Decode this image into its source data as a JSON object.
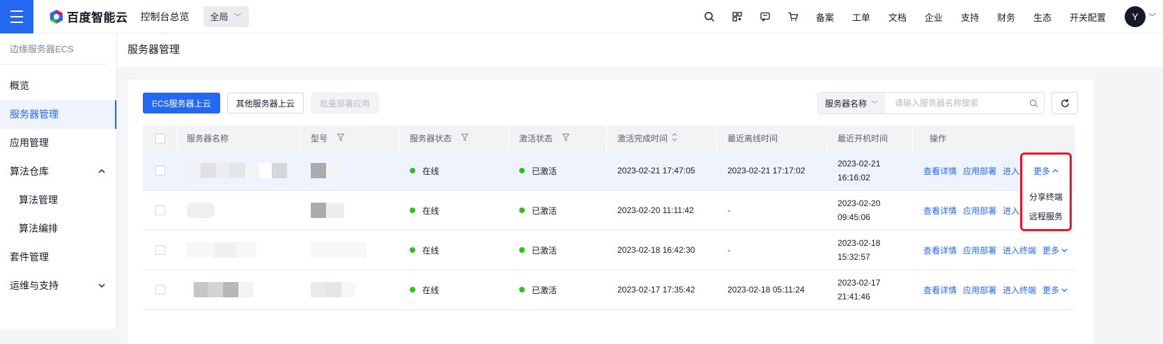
{
  "topbar": {
    "brand": "百度智能云",
    "console": "控制台总览",
    "region": "全局",
    "nav": [
      "备案",
      "工单",
      "文档",
      "企业",
      "支持",
      "财务",
      "生态",
      "开关配置"
    ],
    "avatar": "Y"
  },
  "sidebar": {
    "title": "边缘服务器ECS",
    "items": [
      {
        "label": "概览"
      },
      {
        "label": "服务器管理"
      },
      {
        "label": "应用管理"
      },
      {
        "label": "算法仓库"
      },
      {
        "label": "算法管理"
      },
      {
        "label": "算法编排"
      },
      {
        "label": "套件管理"
      },
      {
        "label": "运维与支持"
      }
    ]
  },
  "page": {
    "title": "服务器管理"
  },
  "toolbar": {
    "ecs_upload": "ECS服务器上云",
    "other_upload": "其他服务器上云",
    "batch_deploy": "批量部署应用",
    "search_type": "服务器名称",
    "search_placeholder": "请输入服务器名称搜索"
  },
  "table": {
    "headers": [
      "服务器名称",
      "型号",
      "服务器状态",
      "激活状态",
      "激活完成时间",
      "最近离线时间",
      "最近开机时间",
      "操作"
    ],
    "rows": [
      {
        "status": "在线",
        "activation": "已激活",
        "activated_at": "2023-02-21 17:47:05",
        "offline_at": "2023-02-21 17:17:02",
        "boot_date": "2023-02-21",
        "boot_time": "16:16:02"
      },
      {
        "status": "在线",
        "activation": "已激活",
        "activated_at": "2023-02-20 11:11:42",
        "offline_at": "-",
        "boot_date": "2023-02-20",
        "boot_time": "09:45:06"
      },
      {
        "status": "在线",
        "activation": "已激活",
        "activated_at": "2023-02-18 16:42:30",
        "offline_at": "-",
        "boot_date": "2023-02-18",
        "boot_time": "15:32:57"
      },
      {
        "status": "在线",
        "activation": "已激活",
        "activated_at": "2023-02-17 17:35:42",
        "offline_at": "2023-02-18 05:11:24",
        "boot_date": "2023-02-17",
        "boot_time": "21:41:46"
      }
    ],
    "ops": {
      "detail": "查看详情",
      "deploy": "应用部署",
      "terminal": "进入终端",
      "more": "更多"
    }
  },
  "dropdown": {
    "items": [
      "分享终端",
      "远程服务"
    ]
  },
  "colors": {
    "primary": "#2468f2",
    "online": "#30bf13",
    "highlight": "#e8142a"
  }
}
